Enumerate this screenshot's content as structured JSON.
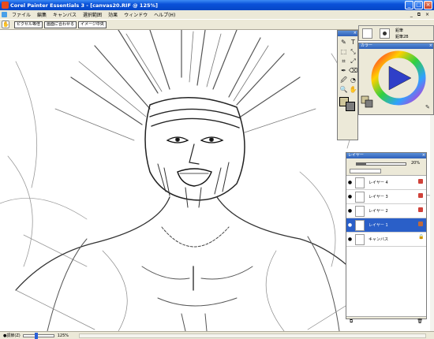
{
  "window": {
    "title": "Corel Painter Essentials 3 - [canvas20.RIF @ 125%]",
    "minimize": "_",
    "maximize": "□",
    "close": "×"
  },
  "menu": {
    "items": [
      "ファイル",
      "編集",
      "キャンバス",
      "選択範囲",
      "効果",
      "ウィンドウ",
      "ヘルプ(H)"
    ],
    "mdi_controls": "_ ⧉ ×"
  },
  "property_bar": {
    "tool_icon": "grabber-icon",
    "buttons": [
      "ピクセル等倍",
      "画面に合わせる",
      "イメージ中央"
    ]
  },
  "toolbox": {
    "tools": [
      {
        "name": "brush-tool-icon",
        "glyph": "✎"
      },
      {
        "name": "text-tool-icon",
        "glyph": "T"
      },
      {
        "name": "shape-tool-icon",
        "glyph": "⬚"
      },
      {
        "name": "selection-tool-icon",
        "glyph": "⤡"
      },
      {
        "name": "crop-tool-icon",
        "glyph": "⌗"
      },
      {
        "name": "transform-tool-icon",
        "glyph": "⤢"
      },
      {
        "name": "pen-tool-icon",
        "glyph": "✒"
      },
      {
        "name": "eraser-tool-icon",
        "glyph": "⌫"
      },
      {
        "name": "dropper-tool-icon",
        "glyph": "🖉"
      },
      {
        "name": "fill-tool-icon",
        "glyph": "◔"
      },
      {
        "name": "magnifier-tool-icon",
        "glyph": "🔍"
      },
      {
        "name": "grabber-tool-icon",
        "glyph": "✋"
      }
    ],
    "main_color": "#cfc69a",
    "additional_color": "#7c7c7c"
  },
  "brush_selector": {
    "category": "鉛筆",
    "variant": "鉛筆2B"
  },
  "color_palette": {
    "title": "カラー",
    "hue_marker_color": "#2f3fc8"
  },
  "layers": {
    "title": "レイヤー",
    "opacity": 0.2,
    "opacity_label": "20%",
    "items": [
      {
        "name": "レイヤー 4",
        "selected": false,
        "marker": "layer-icon"
      },
      {
        "name": "レイヤー 3",
        "selected": false,
        "marker": "layer-icon"
      },
      {
        "name": "レイヤー 2",
        "selected": false,
        "marker": "layer-icon"
      },
      {
        "name": "レイヤー 1",
        "selected": true,
        "marker": "layer-icon"
      },
      {
        "name": "キャンバス",
        "selected": false,
        "marker": "lock-icon"
      }
    ]
  },
  "status": {
    "zoom_label": "●調節(Z)",
    "zoom_value": "125%",
    "zoom_fraction": 0.3
  }
}
